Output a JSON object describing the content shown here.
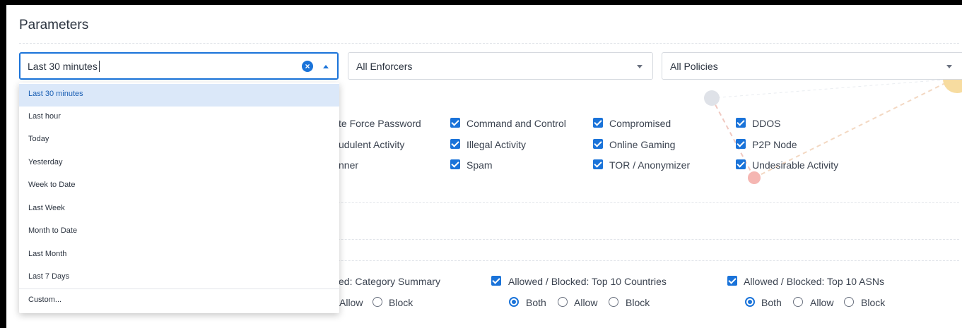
{
  "page": {
    "title": "Parameters"
  },
  "filters": {
    "time_range": {
      "value": "Last 30 minutes",
      "clear_icon": "clear-circle-icon",
      "toggle_icon": "caret-up-icon"
    },
    "enforcers": {
      "value": "All Enforcers",
      "toggle_icon": "caret-down-icon"
    },
    "policies": {
      "value": "All Policies",
      "toggle_icon": "caret-down-icon"
    }
  },
  "time_dropdown": {
    "options": [
      "Last 30 minutes",
      "Last hour",
      "Today",
      "Yesterday",
      "Week to Date",
      "Last Week",
      "Month to Date",
      "Last Month",
      "Last 7 Days"
    ],
    "custom": "Custom...",
    "selected": "Last 30 minutes"
  },
  "categories": [
    {
      "label": "te Force Password",
      "checked": false
    },
    {
      "label": "Command and Control",
      "checked": true
    },
    {
      "label": "Compromised",
      "checked": true
    },
    {
      "label": "DDOS",
      "checked": true
    },
    {
      "label": "udulent Activity",
      "checked": false
    },
    {
      "label": "Illegal Activity",
      "checked": true
    },
    {
      "label": "Online Gaming",
      "checked": true
    },
    {
      "label": "P2P Node",
      "checked": true
    },
    {
      "label": "nner",
      "checked": false
    },
    {
      "label": "Spam",
      "checked": true
    },
    {
      "label": "TOR / Anonymizer",
      "checked": true
    },
    {
      "label": "Undesirable Activity",
      "checked": true
    }
  ],
  "reports": [
    {
      "label": "ed: Category Summary",
      "checked": false,
      "options": [
        "Allow",
        "Block"
      ],
      "selected": ""
    },
    {
      "label": "Allowed / Blocked: Top 10 Countries",
      "checked": true,
      "options": [
        "Both",
        "Allow",
        "Block"
      ],
      "selected": "Both"
    },
    {
      "label": "Allowed / Blocked: Top 10 ASNs",
      "checked": true,
      "options": [
        "Both",
        "Allow",
        "Block"
      ],
      "selected": "Both"
    }
  ],
  "colors": {
    "accent": "#1a73d9",
    "selected_bg": "#dbe8f9",
    "text": "#2c3440"
  }
}
